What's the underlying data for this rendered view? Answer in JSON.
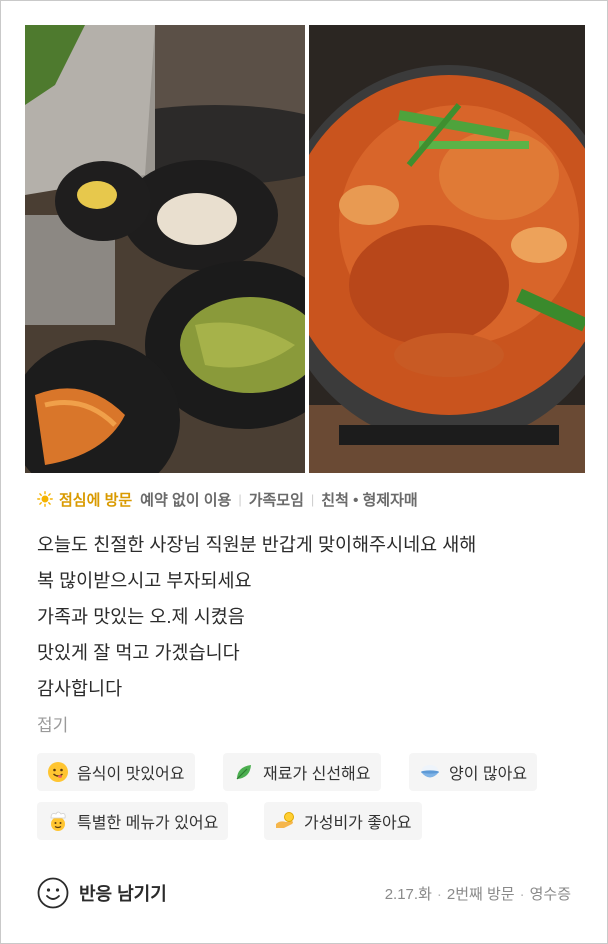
{
  "visit": {
    "icon": "sun-icon",
    "label": "점심에 방문",
    "tags": [
      "예약 없이 이용",
      "가족모임",
      "친척 • 형제자매"
    ]
  },
  "review": {
    "lines": [
      "오늘도 친절한 사장님 직원분 반갑게 맞이해주시네요 새해",
      "복 많이받으시고 부자되세요",
      "가족과 맛있는 오.제 시켰음",
      "맛있게 잘 먹고 가겠습니다",
      "감사합니다"
    ],
    "fold_label": "접기"
  },
  "keywords": [
    {
      "icon": "yummy-face-icon",
      "label": "음식이 맛있어요"
    },
    {
      "icon": "leaf-icon",
      "label": "재료가 신선해요"
    },
    {
      "icon": "rice-bowl-icon",
      "label": "양이 많아요"
    },
    {
      "icon": "chef-icon",
      "label": "특별한 메뉴가 있어요"
    },
    {
      "icon": "coin-hand-icon",
      "label": "가성비가 좋아요"
    }
  ],
  "footer": {
    "react_label": "반응 남기기",
    "date": "2.17.화",
    "visit_count": "2번째 방문",
    "receipt": "영수증"
  },
  "colors": {
    "visit_accent": "#d99a00",
    "chip_bg": "#f5f5f5"
  }
}
